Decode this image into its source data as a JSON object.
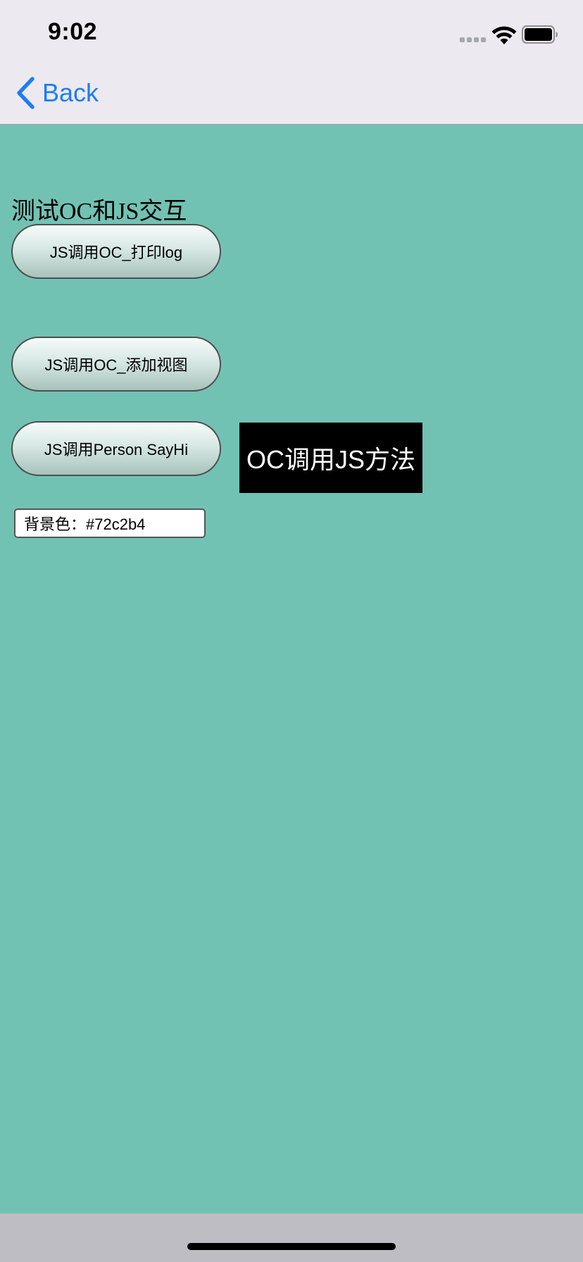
{
  "status_bar": {
    "time": "9:02"
  },
  "nav": {
    "back_label": "Back"
  },
  "page": {
    "title": "测试OC和JS交互",
    "buttons": {
      "log": "JS调用OC_打印log",
      "add_view": "JS调用OC_添加视图",
      "person": "JS调用Person SayHi"
    },
    "native_button": "OC调用JS方法",
    "color_field": {
      "value": "背景色：#72c2b4"
    }
  },
  "colors": {
    "background": "#72c2b4",
    "nav_accent": "#1f7cf5",
    "native_button_bg": "#000000"
  },
  "icons": {
    "back": "chevron-left-icon",
    "signal": "cellular-signal-icon",
    "wifi": "wifi-icon",
    "battery": "battery-icon"
  }
}
